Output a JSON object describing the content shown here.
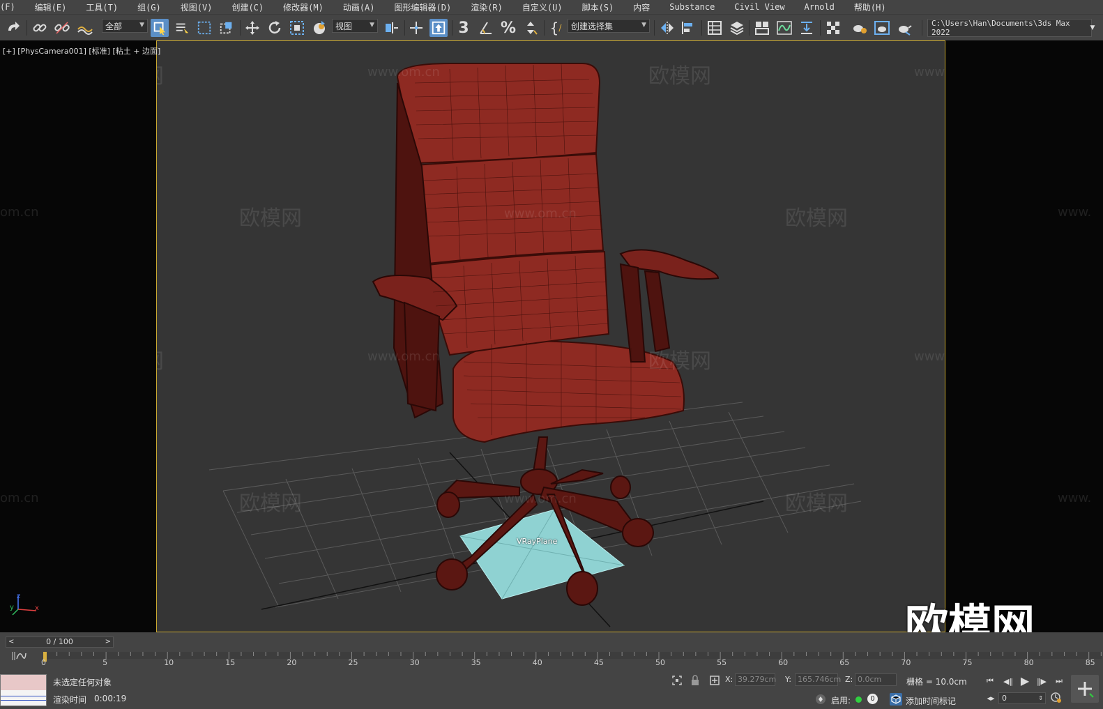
{
  "menu": {
    "items": [
      "(F)",
      "编辑(E)",
      "工具(T)",
      "组(G)",
      "视图(V)",
      "创建(C)",
      "修改器(M)",
      "动画(A)",
      "图形编辑器(D)",
      "渲染(R)",
      "自定义(U)",
      "脚本(S)",
      "内容",
      "Substance",
      "Civil View",
      "Arnold",
      "帮助(H)"
    ]
  },
  "toolbar": {
    "selection_filter": "全部",
    "reference_coord": "视图",
    "snap_label": "3",
    "named_selection": "创建选择集",
    "project_path": "C:\\Users\\Han\\Documents\\3ds Max 2022"
  },
  "viewport": {
    "label": "[+] [PhysCamera001] [标准] [粘土 + 边面]",
    "object_label": "VRayPlane",
    "axis_x": "x",
    "axis_y": "y",
    "axis_z": "z",
    "watermark_cn": "欧模网",
    "watermark_url": "www.om.cn",
    "watermark_url_short": "om.cn",
    "watermark_url_left": "www.",
    "big_watermark": "欧模网"
  },
  "timeline": {
    "frame_display": "0 / 100",
    "ticks": [
      "0",
      "5",
      "10",
      "15",
      "20",
      "25",
      "30",
      "35",
      "40",
      "45",
      "50",
      "55",
      "60",
      "65",
      "70",
      "75",
      "80",
      "85"
    ]
  },
  "status": {
    "selection": "未选定任何对象",
    "render_time_label": "渲染时间",
    "render_time": "0:00:19",
    "x_label": "X:",
    "x_value": "39.279cm",
    "y_label": "Y:",
    "y_value": "165.746cm",
    "z_label": "Z:",
    "z_value": "0.0cm",
    "grid": "栅格 = 10.0cm",
    "enable_label": "启用:",
    "enable_count": "0",
    "add_time_tag": "添加时间标记",
    "frame_field": "0"
  },
  "colors": {
    "viewport_border": "#c9a830",
    "active_tool": "#5b8fc7",
    "chair": "#8e2a22",
    "plane": "#8fd2d2"
  }
}
